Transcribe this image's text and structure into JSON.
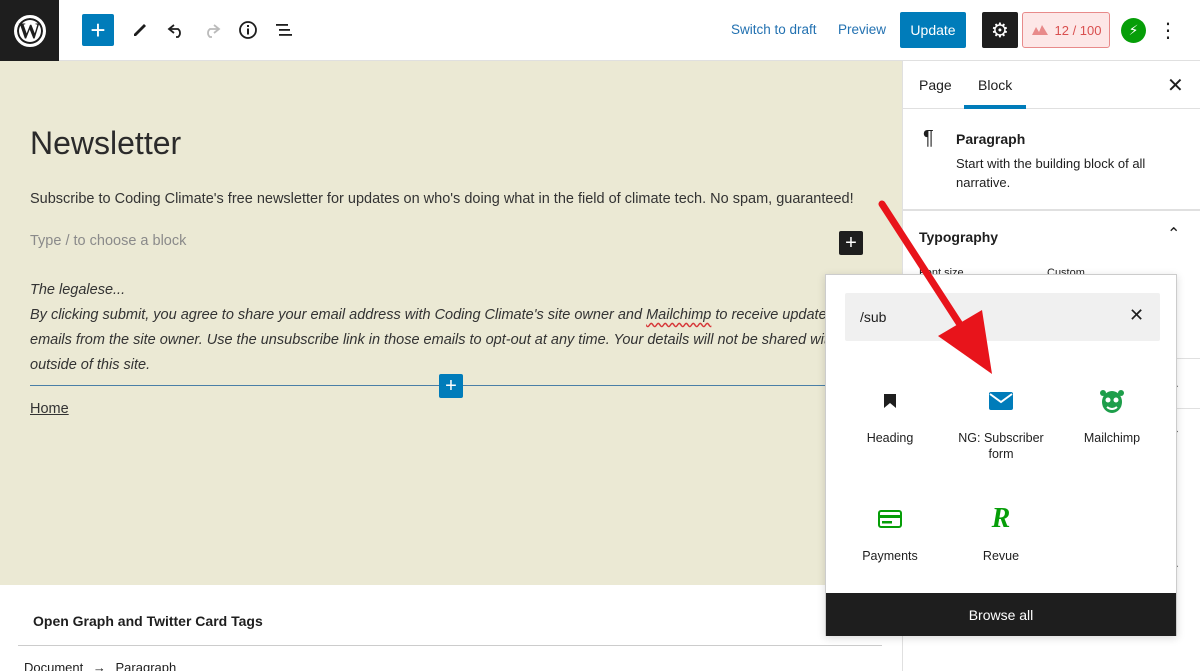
{
  "toolbar": {
    "switch_to_draft": "Switch to draft",
    "preview": "Preview",
    "update": "Update",
    "score": "12 / 100",
    "icons": [
      "wordpress-icon",
      "plus-icon",
      "pencil-icon",
      "undo-icon",
      "redo-icon",
      "info-icon",
      "list-view-icon",
      "gear-icon",
      "score-icon",
      "jetpack-icon",
      "more-icon"
    ]
  },
  "editor": {
    "title": "Newsletter",
    "paragraph": "Subscribe to Coding Climate's free newsletter for updates on who's doing what in the field of climate tech. No spam, guaranteed!",
    "placeholder": "Type / to choose a block",
    "legalese_line1": "The legalese...",
    "legalese_line2a": "By clicking submit, you agree to share your email address with Coding Climate's site owner and ",
    "legalese_mailchimp": "Mailchimp",
    "legalese_line2b": " to receive updates and ot",
    "legalese_line3": "emails from the site owner. Use the unsubscribe link in those emails to opt-out at any time. Your details will not be shared with anyo",
    "legalese_line4": "outside of this site.",
    "home_link": "Home",
    "background": "#ebe9d4"
  },
  "metabox": {
    "title": "Open Graph and Twitter Card Tags"
  },
  "breadcrumb": {
    "document": "Document",
    "arrow": "→",
    "paragraph": "Paragraph"
  },
  "sidebar": {
    "tab_page": "Page",
    "tab_block": "Block",
    "block_name": "Paragraph",
    "block_desc": "Start with the building block of all narrative.",
    "typography": "Typography",
    "font_size": "Font size",
    "custom": "Custom"
  },
  "inserter": {
    "search_value": "/sub",
    "items": [
      {
        "label": "Heading",
        "icon": "bookmark-icon"
      },
      {
        "label": "NG: Subscriber form",
        "icon": "envelope-icon"
      },
      {
        "label": "Mailchimp",
        "icon": "mailchimp-icon"
      },
      {
        "label": "Payments",
        "icon": "credit-card-icon"
      },
      {
        "label": "Revue",
        "icon": "revue-icon"
      }
    ],
    "browse_all": "Browse all"
  },
  "colors": {
    "accent": "#007cba",
    "annotation_arrow": "#e8141b",
    "score_text": "#d94f4f",
    "jetpack_green": "#069e08",
    "mailchimp_green": "#1d9e4a"
  }
}
